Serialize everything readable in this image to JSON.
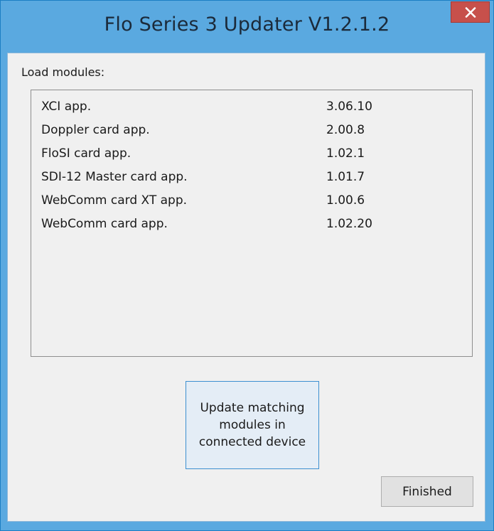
{
  "window": {
    "title": "Flo Series 3 Updater V1.2.1.2",
    "close_icon": "close-icon"
  },
  "load_label": "Load modules:",
  "modules": [
    {
      "name": "XCI app.",
      "version": "3.06.10"
    },
    {
      "name": "Doppler card app.",
      "version": "2.00.8"
    },
    {
      "name": "FloSI card app.",
      "version": "1.02.1"
    },
    {
      "name": "SDI-12 Master card app.",
      "version": "1.01.7"
    },
    {
      "name": "WebComm card XT app.",
      "version": "1.00.6"
    },
    {
      "name": "WebComm card app.",
      "version": "1.02.20"
    }
  ],
  "buttons": {
    "update_label": "Update matching modules in connected device",
    "finished_label": "Finished"
  },
  "colors": {
    "titlebar": "#5aa9e0",
    "close_button": "#c7504b",
    "client_bg": "#f0f0f0"
  }
}
